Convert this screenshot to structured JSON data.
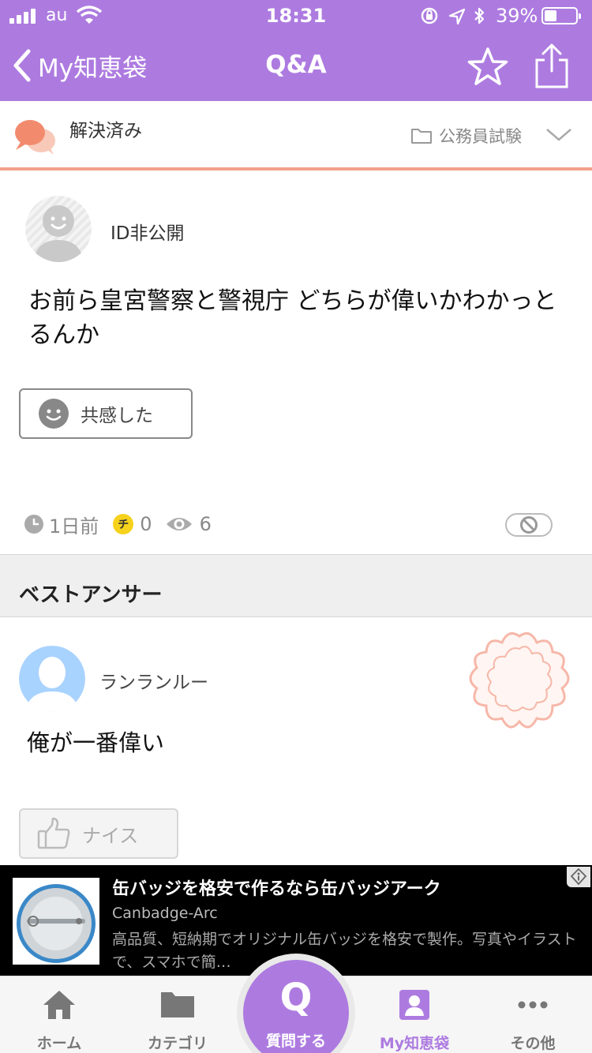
{
  "status_bar": {
    "carrier": "au",
    "time": "18:31",
    "battery_percent": "39%",
    "battery_level": 0.39,
    "icons": [
      "signal-icon",
      "wifi-icon",
      "orientation-lock-icon",
      "location-icon",
      "bluetooth-icon",
      "battery-icon"
    ]
  },
  "nav": {
    "back_label": "My知恵袋",
    "title": "Q&A",
    "icons": [
      "chevron-left-icon",
      "star-icon",
      "share-icon"
    ]
  },
  "solved_bar": {
    "status_label": "解決済み",
    "category": "公務員試験"
  },
  "question": {
    "user": "ID非公開",
    "text": "お前ら皇宮警察と警視庁 どちらが偉いかわかっとるんか",
    "empathy_label": "共感した",
    "time_ago": "1日前",
    "coin_label": "チ",
    "coin_count": "0",
    "view_count": "6"
  },
  "best_answer": {
    "header": "ベストアンサー",
    "user": "ランランルー",
    "text": "俺が一番偉い",
    "nice_label": "ナイス"
  },
  "ad": {
    "title": "缶バッジを格安で作るなら缶バッジアーク",
    "source": "Canbadge-Arc",
    "description": "高品質、短納期でオリジナル缶バッジを格安で製作。写真やイラストで、スマホで簡…"
  },
  "tabbar": {
    "items": [
      {
        "label": "ホーム",
        "icon": "home-icon"
      },
      {
        "label": "カテゴリ",
        "icon": "folder-icon"
      },
      {
        "label": "質問する",
        "icon": "q-icon"
      },
      {
        "label": "My知恵袋",
        "icon": "profile-icon"
      },
      {
        "label": "その他",
        "icon": "more-icon"
      }
    ],
    "ask_glyph": "Q",
    "active": "My知恵袋"
  },
  "colors": {
    "accent": "#ad7be0",
    "solved_line": "#f2a08a",
    "coin": "#f6d21c"
  }
}
